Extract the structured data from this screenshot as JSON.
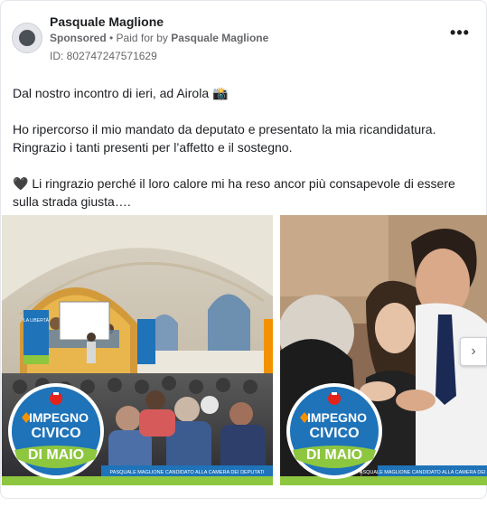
{
  "post": {
    "page_name": "Pasquale Maglione",
    "sponsored_label": "Sponsored",
    "separator": " • ",
    "paid_for_label": "Paid for by",
    "payer_name": "Pasquale Maglione",
    "ad_id": "ID: 802747247571629",
    "more_icon": "more-horizontal-icon",
    "more_glyph": "•••"
  },
  "body": {
    "line_1": "Dal nostro incontro di ieri, ad Airola 📸",
    "line_2": "Ho ripercorso il mio mandato da deputato e presentato la mia ricandidatura.",
    "line_3": "Ringrazio i tanti presenti per l’affetto e il sostegno.",
    "line_4": "🖤 Li ringrazio perché il loro calore mi ha reso ancor più consapevole di essere",
    "line_5": "sulla strada giusta…."
  },
  "carousel": {
    "slides": [
      {
        "logo_line_1": "IMPEGNO",
        "logo_line_2": "CIVICO",
        "logo_name": "DI MAIO",
        "caption": "PASQUALE MAGLIONE CANDIDATO ALLA CAMERA DEI DEPUTATI",
        "banner_left": "IMPEGNO CIVICO",
        "banner_right": "LA LIBERTÀ"
      },
      {
        "logo_line_1": "IMPEGNO",
        "logo_line_2": "CIVICO",
        "logo_name": "DI MAIO",
        "caption": "PASQUALE MAGLIONE CANDIDATO ALLA CAMERA DEI DEPUTATI"
      }
    ],
    "next_glyph": "›",
    "next_icon": "chevron-right-icon"
  },
  "colors": {
    "logo_blue": "#1e73b9",
    "logo_green": "#8dc63f",
    "logo_orange": "#f39200",
    "logo_red": "#e2231a",
    "text_secondary": "#65676b"
  }
}
